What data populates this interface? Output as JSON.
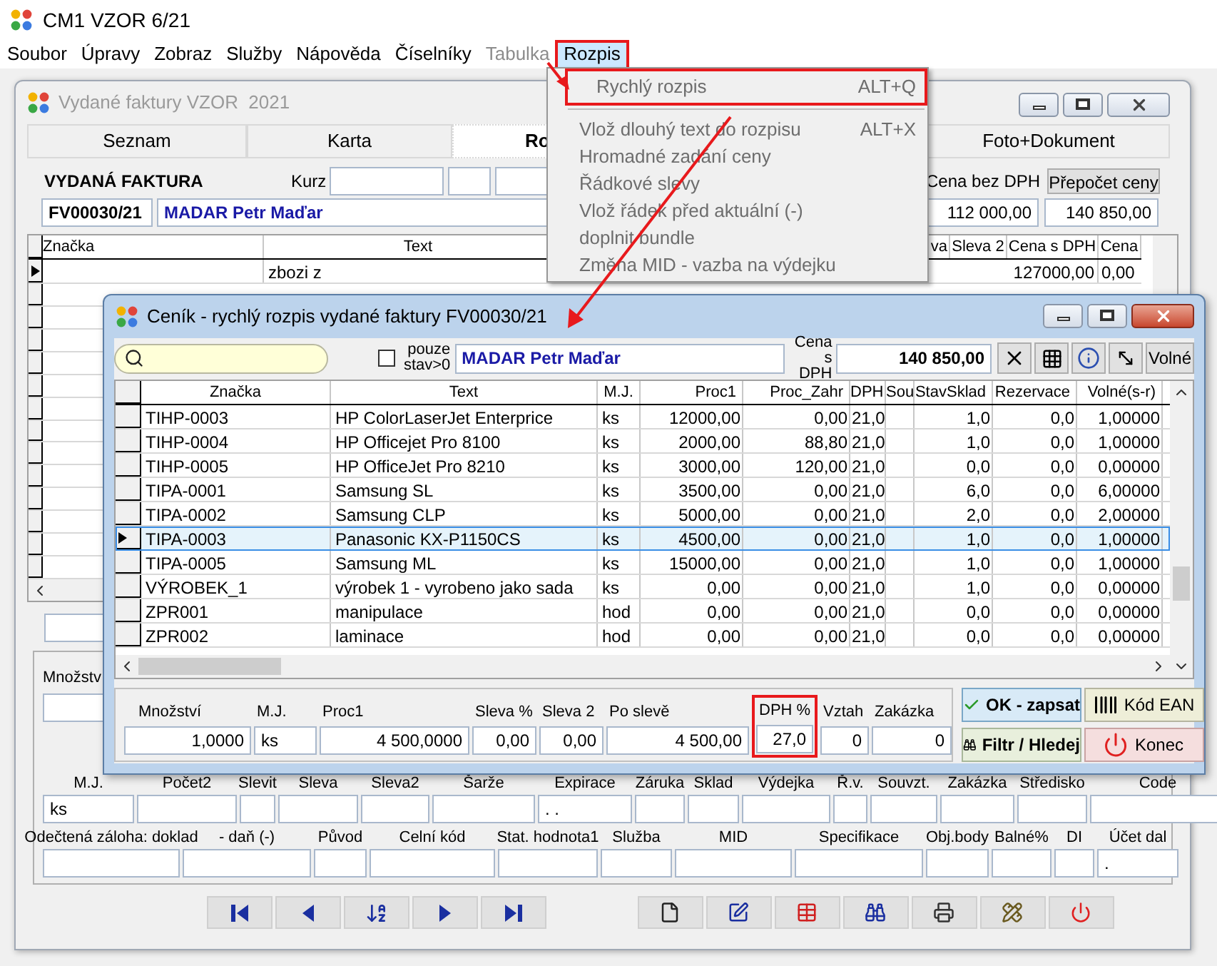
{
  "app": {
    "title": "CM1 VZOR 6/21"
  },
  "menu_bar": [
    {
      "label": "Soubor",
      "disabled": false,
      "selected": false,
      "highlighted": false
    },
    {
      "label": "Úpravy",
      "disabled": false,
      "selected": false,
      "highlighted": false
    },
    {
      "label": "Zobraz",
      "disabled": false,
      "selected": false,
      "highlighted": false
    },
    {
      "label": "Služby",
      "disabled": false,
      "selected": false,
      "highlighted": false
    },
    {
      "label": "Nápověda",
      "disabled": false,
      "selected": false,
      "highlighted": false
    },
    {
      "label": "Číselníky",
      "disabled": false,
      "selected": false,
      "highlighted": false
    },
    {
      "label": "Tabulka",
      "disabled": true,
      "selected": false,
      "highlighted": false
    },
    {
      "label": "Rozpis",
      "disabled": false,
      "selected": true,
      "highlighted": true
    }
  ],
  "menu_dropdown": {
    "items": [
      {
        "label": "Rychlý rozpis",
        "shortcut": "ALT+Q",
        "disabled": true,
        "highlighted": true,
        "separator_after": true
      },
      {
        "label": "Vlož dlouhý text do rozpisu",
        "shortcut": "ALT+X",
        "disabled": true,
        "highlighted": false,
        "separator_after": false
      },
      {
        "label": "Hromadné zadání ceny",
        "disabled": true,
        "highlighted": false,
        "separator_after": false
      },
      {
        "label": "Řádkové slevy",
        "disabled": true,
        "highlighted": false,
        "separator_after": false
      },
      {
        "label": "Vlož řádek před aktuální (-)",
        "disabled": true,
        "highlighted": false,
        "separator_after": false
      },
      {
        "label": "doplnit bundle",
        "disabled": true,
        "highlighted": false,
        "separator_after": false
      },
      {
        "label": "Změna MID - vazba na výdejku",
        "disabled": true,
        "highlighted": false,
        "separator_after": false
      }
    ]
  },
  "main_window": {
    "title": "Vydané faktury VZOR  2021",
    "tabs": [
      {
        "label": "Seznam",
        "selected": false
      },
      {
        "label": "Karta",
        "selected": false
      },
      {
        "label": "Ro",
        "selected": true
      },
      {
        "label": "Foto+Dokument",
        "selected": false
      }
    ],
    "document_label": "VYDANÁ FAKTURA",
    "kurz_label": "Kurz",
    "invoice_number": "FV00030/21",
    "customer": "MADAR Petr Maďar",
    "price_without_vat_label": "Cena bez DPH",
    "recalc_button": "Přepočet ceny",
    "price_without_vat": "112 000,00",
    "price_with_vat": "140 850,00",
    "table": {
      "columns": [
        "Značka",
        "Text",
        "va",
        "Sleva 2",
        "Cena s DPH",
        "Cena"
      ],
      "rows": [
        {
          "text": "zbozi z",
          "cena_s_dph": "127000,00",
          "cena": "0,00",
          "selected": true
        }
      ]
    },
    "quantity_label": "Množstv",
    "detail_row_1": [
      {
        "label": "M.J.",
        "value": "ks"
      },
      {
        "label": "Počet2"
      },
      {
        "label": "Slevit"
      },
      {
        "label": "Sleva"
      },
      {
        "label": "Sleva2"
      },
      {
        "label": "Šarže"
      },
      {
        "label": "Expirace",
        "value": ". ."
      },
      {
        "label": "Záruka"
      },
      {
        "label": "Sklad"
      },
      {
        "label": "Výdejka"
      },
      {
        "label": "Ř.v."
      },
      {
        "label": "Souvzt."
      },
      {
        "label": "Zakázka"
      },
      {
        "label": "Středisko"
      },
      {
        "label": "Code"
      }
    ],
    "detail_row_2": [
      {
        "label": "Odečtená záloha: doklad"
      },
      {
        "label": "- daň (-)"
      },
      {
        "label": "Původ"
      },
      {
        "label": "Celní kód"
      },
      {
        "label": "Stat. hodnota1"
      },
      {
        "label": "Služba"
      },
      {
        "label": "MID"
      },
      {
        "label": "Specifikace"
      },
      {
        "label": "Obj.body"
      },
      {
        "label": "Balné%"
      },
      {
        "label": "DI"
      },
      {
        "label": "Účet dal",
        "value": "."
      }
    ]
  },
  "dialog": {
    "title": "Ceník - rychlý rozpis vydané faktury FV00030/21",
    "stock_filter": {
      "label": "pouze stav>0",
      "checked": false
    },
    "customer": "MADAR Petr Maďar",
    "price_label": "Cena s DPH",
    "price": "140 850,00",
    "free_button": "Volné",
    "columns": [
      "Značka",
      "Text",
      "M.J.",
      "Proc1",
      "Proc_Zahr",
      "DPH",
      "Sou",
      "StavSklad",
      "Rezervace",
      "Volné(s-r)"
    ],
    "rows": [
      {
        "znacka": "TIHP-0003",
        "text": "HP ColorLaserJet Enterprice",
        "mj": "ks",
        "proc1": "12000,00",
        "proc_zahr": "0,00",
        "dph": "21,0",
        "stav": "1,0",
        "rezervace": "0,0",
        "volne": "1,00000",
        "selected": false
      },
      {
        "znacka": "TIHP-0004",
        "text": "HP Officejet Pro 8100",
        "mj": "ks",
        "proc1": "2000,00",
        "proc_zahr": "88,80",
        "dph": "21,0",
        "stav": "1,0",
        "rezervace": "0,0",
        "volne": "1,00000",
        "selected": false
      },
      {
        "znacka": "TIHP-0005",
        "text": "HP OfficeJet Pro 8210",
        "mj": "ks",
        "proc1": "3000,00",
        "proc_zahr": "120,00",
        "dph": "21,0",
        "stav": "0,0",
        "rezervace": "0,0",
        "volne": "0,00000",
        "selected": false
      },
      {
        "znacka": "TIPA-0001",
        "text": "Samsung SL",
        "mj": "ks",
        "proc1": "3500,00",
        "proc_zahr": "0,00",
        "dph": "21,0",
        "stav": "6,0",
        "rezervace": "0,0",
        "volne": "6,00000",
        "selected": false
      },
      {
        "znacka": "TIPA-0002",
        "text": "Samsung CLP",
        "mj": "ks",
        "proc1": "5000,00",
        "proc_zahr": "0,00",
        "dph": "21,0",
        "stav": "2,0",
        "rezervace": "0,0",
        "volne": "2,00000",
        "selected": false
      },
      {
        "znacka": "TIPA-0003",
        "text": "Panasonic KX-P1150CS",
        "mj": "ks",
        "proc1": "4500,00",
        "proc_zahr": "0,00",
        "dph": "21,0",
        "stav": "1,0",
        "rezervace": "0,0",
        "volne": "1,00000",
        "selected": true
      },
      {
        "znacka": "TIPA-0005",
        "text": "Samsung ML",
        "mj": "ks",
        "proc1": "15000,00",
        "proc_zahr": "0,00",
        "dph": "21,0",
        "stav": "1,0",
        "rezervace": "0,0",
        "volne": "1,00000",
        "selected": false
      },
      {
        "znacka": "VÝROBEK_1",
        "text": "výrobek 1 - vyrobeno jako sada",
        "mj": "ks",
        "proc1": "0,00",
        "proc_zahr": "0,00",
        "dph": "21,0",
        "stav": "1,0",
        "rezervace": "0,0",
        "volne": "0,00000",
        "selected": false
      },
      {
        "znacka": "ZPR001",
        "text": "manipulace",
        "mj": "hod",
        "proc1": "0,00",
        "proc_zahr": "0,00",
        "dph": "21,0",
        "stav": "0,0",
        "rezervace": "0,0",
        "volne": "0,00000",
        "selected": false
      },
      {
        "znacka": "ZPR002",
        "text": "laminace",
        "mj": "hod",
        "proc1": "0,00",
        "proc_zahr": "0,00",
        "dph": "21,0",
        "stav": "0,0",
        "rezervace": "0,0",
        "volne": "0,00000",
        "selected": false
      }
    ],
    "form": [
      {
        "label": "Množství",
        "value": "1,0000",
        "highlighted": false
      },
      {
        "label": "M.J.",
        "value": "ks",
        "highlighted": false
      },
      {
        "label": "Proc1",
        "value": "4 500,0000",
        "highlighted": false
      },
      {
        "label": "Sleva %",
        "value": "0,00",
        "highlighted": false
      },
      {
        "label": "Sleva 2",
        "value": "0,00",
        "highlighted": false
      },
      {
        "label": "Po slevě",
        "value": "4 500,00",
        "highlighted": false
      },
      {
        "label": "DPH %",
        "value": "27,0",
        "highlighted": true
      },
      {
        "label": "Vztah",
        "value": "0",
        "highlighted": false
      },
      {
        "label": "Zakázka",
        "value": "0",
        "highlighted": false
      }
    ],
    "buttons": [
      {
        "kind": "ok",
        "label": "OK - zapsat"
      },
      {
        "kind": "ean",
        "label": "Kód EAN"
      },
      {
        "kind": "filter",
        "label": "Filtr / Hledej"
      },
      {
        "kind": "close",
        "label": "Konec"
      }
    ]
  }
}
